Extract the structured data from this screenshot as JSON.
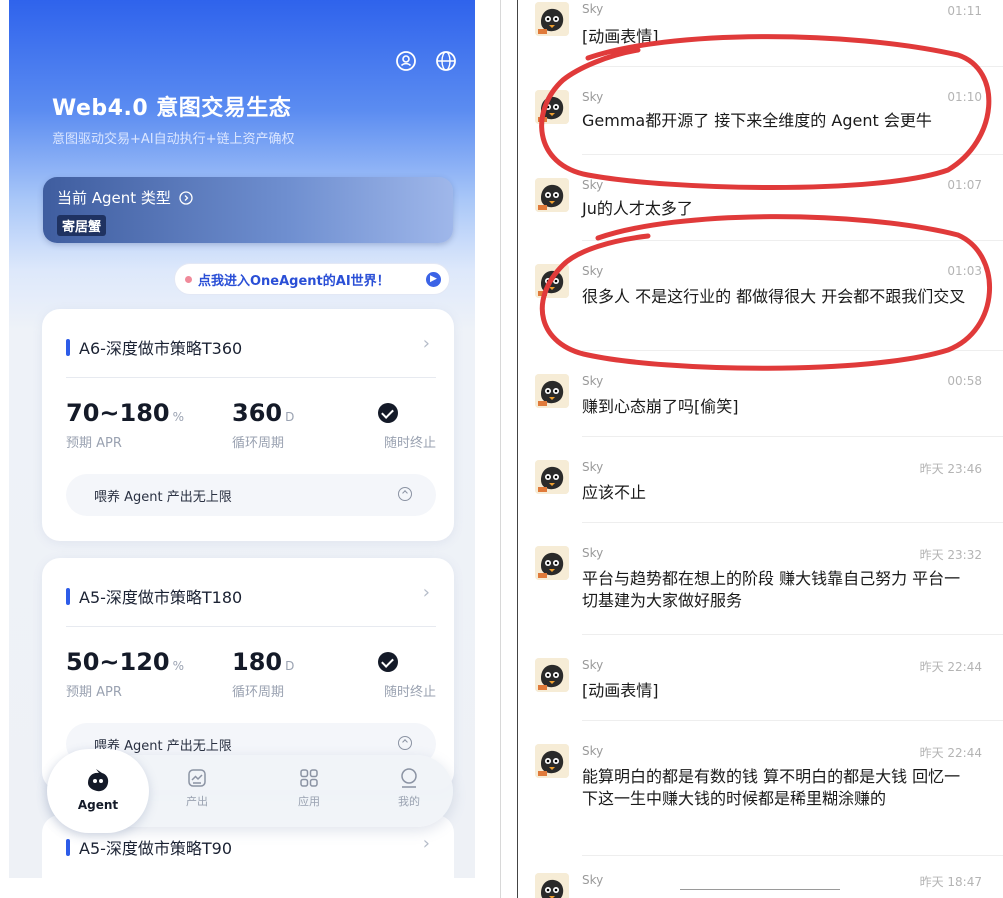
{
  "app": {
    "title": "Web4.0 意图交易生态",
    "subtitle": "意图驱动交易+AI自动执行+链上资产确权",
    "agent_type_label": "当前 Agent 类型",
    "agent_type_value": "寄居蟹",
    "promo_text": "点我进入OneAgent的AI世界！",
    "strategies": [
      {
        "name": "A6-深度做市策略T360",
        "apr": "70~180",
        "apr_unit": "%",
        "apr_label": "预期 APR",
        "cycle": "360",
        "cycle_unit": "D",
        "cycle_label": "循环周期",
        "stop_label": "随时终止",
        "feed_text": "喂养 Agent 产出无上限"
      },
      {
        "name": "A5-深度做市策略T180",
        "apr": "50~120",
        "apr_unit": "%",
        "apr_label": "预期 APR",
        "cycle": "180",
        "cycle_unit": "D",
        "cycle_label": "循环周期",
        "stop_label": "随时终止",
        "feed_text": "喂养 Agent 产出无上限"
      },
      {
        "name": "A5-深度做市策略T90"
      }
    ],
    "nav": [
      {
        "label": "Agent",
        "icon": "agent-icon"
      },
      {
        "label": "产出",
        "icon": "chart-icon"
      },
      {
        "label": "应用",
        "icon": "grid-icon"
      },
      {
        "label": "我的",
        "icon": "user-icon"
      }
    ]
  },
  "chat": {
    "messages": [
      {
        "name": "Sky",
        "time": "01:11",
        "text": "[动画表情]"
      },
      {
        "name": "Sky",
        "time": "01:10",
        "text": "Gemma都开源了 接下来全维度的 Agent 会更牛"
      },
      {
        "name": "Sky",
        "time": "01:07",
        "text": "Ju的人才太多了"
      },
      {
        "name": "Sky",
        "time": "01:03",
        "text": "很多人 不是这行业的  都做得很大 开会都不跟我们交叉"
      },
      {
        "name": "Sky",
        "time": "00:58",
        "text": "赚到心态崩了吗[偷笑]"
      },
      {
        "name": "Sky",
        "time": "昨天 23:46",
        "text": "应该不止"
      },
      {
        "name": "Sky",
        "time": "昨天 23:32",
        "text": "平台与趋势都在想上的阶段 赚大钱靠自己努力 平台一切基建为大家做好服务"
      },
      {
        "name": "Sky",
        "time": "昨天 22:44",
        "text": "[动画表情]"
      },
      {
        "name": "Sky",
        "time": "昨天 22:44",
        "text": "能算明白的都是有数的钱 算不明白的都是大钱 回忆一下这一生中赚大钱的时候都是稀里糊涂赚的"
      },
      {
        "name": "Sky",
        "time": "昨天 18:47",
        "text": ""
      }
    ]
  },
  "colors": {
    "accent": "#2d5ce8",
    "annotation": "#e03a3a"
  }
}
